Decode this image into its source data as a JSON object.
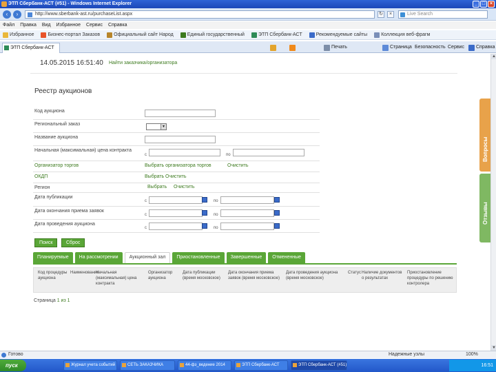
{
  "window": {
    "title": "ЭТП Сбербанк-АСТ (#51) - Windows Internet Explorer"
  },
  "addressbar": {
    "url": "http://www.sberbank-ast.ru/purchaseList.aspx",
    "search_placeholder": "Live Search"
  },
  "menu": [
    "Файл",
    "Правка",
    "Вид",
    "Избранное",
    "Сервис",
    "Справка"
  ],
  "favorites": [
    {
      "label": "Избранное",
      "color": "#e9b73b"
    },
    {
      "label": "Бизнес-портал Заказов",
      "color": "#e8532a"
    },
    {
      "label": "Официальный сайт Народ",
      "color": "#b8862b"
    },
    {
      "label": "Единый государственный",
      "color": "#3c7a1e"
    },
    {
      "label": "ЭТП Сбербанк-АСТ",
      "color": "#2e8b57"
    },
    {
      "label": "Рекомендуемые сайты",
      "color": "#3b6bc9"
    },
    {
      "label": "Коллекция веб-фрагм",
      "color": "#7a8fb8"
    }
  ],
  "tab": {
    "label": "ЭТП Сбербанк-АСТ (#51)"
  },
  "command_bar": [
    {
      "label": "",
      "icon": "home-icon",
      "color": "#e3a42d"
    },
    {
      "label": "",
      "icon": "rss-icon",
      "color": "#f08a1c"
    },
    {
      "label": "Печать",
      "icon": "print-icon",
      "color": "#7d8ea8"
    },
    {
      "label": "Страница",
      "icon": "page-icon",
      "color": "#5d8ad8"
    },
    {
      "label": "Безопасность",
      "icon": "security-icon",
      "color": "#5d8ad8"
    },
    {
      "label": "Сервис",
      "icon": "tools-icon",
      "color": "#5d8ad8"
    },
    {
      "label": "Справка",
      "icon": "help-icon",
      "color": "#3b6bc9"
    }
  ],
  "header": {
    "date": "14.05.2015 16:51:40",
    "user_text": "Найти заказчика/организатора"
  },
  "page": {
    "heading": "Реестр аукционов",
    "filters": {
      "code": "Код аукциона",
      "region": "Региональный заказ",
      "name": "Название аукциона",
      "price": "Начальная (максимальная) цена контракта",
      "price_from": "с",
      "price_to": "по",
      "organizer": "Организатор торгов",
      "organizer_links": [
        "Выбрать организатора торгов",
        "Очистить"
      ],
      "okdp": "ОКДП",
      "okdp_links": [
        "Выбрать",
        "Очистить"
      ],
      "regions": "Регион",
      "regions_links": [
        "Выбрать",
        "Очистить"
      ],
      "pub_date": "Дата публикации",
      "end_date": "Дата окончания приема заявок",
      "auction_date": "Дата проведения аукциона",
      "date_from": "с",
      "date_to": "по"
    },
    "buttons": {
      "search": "Поиск",
      "clear": "Сброс"
    },
    "tabs": [
      {
        "label": "Планируемые",
        "active": false
      },
      {
        "label": "На рассмотрении",
        "active": false
      },
      {
        "label": "Аукционный зал",
        "active": true
      },
      {
        "label": "Приостановленные",
        "active": false
      },
      {
        "label": "Завершенные",
        "active": false
      },
      {
        "label": "Отмененные",
        "active": false
      }
    ],
    "columns": [
      "Код процедуры аукциона",
      "Наименование",
      "Начальная (максимальная) цена контракта",
      "Организатор аукциона",
      "Дата публикации (время московское)",
      "Дата окончания приема заявок (время московское)",
      "Дата проведения аукциона (время московское)",
      "Статус",
      "Наличие документов о результатах",
      "Приостановление процедуры по решению контролера"
    ],
    "pager": {
      "label": "Страница",
      "value": "1",
      "next": "из 1"
    }
  },
  "side_tabs": {
    "questions": "Вопросы",
    "feedback": "Отзывы"
  },
  "statusbar": {
    "status": "Готово",
    "zone": "Надежные узлы",
    "zoom": "100%"
  },
  "taskbar": {
    "start": "пуск",
    "items": [
      "Журнал учета событий",
      "СЕТЬ ЗАКАЗЧИКА",
      "44-фз_ведение 2014",
      "ЭТП Сбербанк-АСТ",
      "ЭТП Сбербанк-АСТ (#51)"
    ],
    "time": "16:51"
  }
}
